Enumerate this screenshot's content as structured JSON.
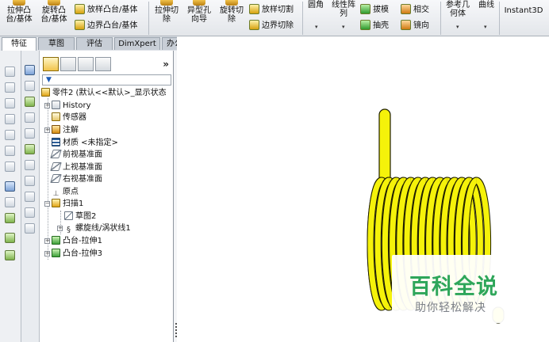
{
  "ribbon": {
    "extrude_boss": "拉伸凸\n台/基体",
    "revolve_boss": "旋转凸\n台/基体",
    "sweep_boss": "扫描",
    "loft_boss": "放样凸台/基体",
    "boundary_boss": "边界凸台/基体",
    "extrude_cut": "拉伸切\n除",
    "hole_wizard": "异型孔\n向导",
    "revolve_cut": "旋转切\n除",
    "loft_cut": "放样切割",
    "boundary_cut": "边界切除",
    "fillet": "圆角",
    "linear_pattern": "线性阵\n列",
    "draft": "拔模",
    "shell": "抽壳",
    "intersect": "相交",
    "mirror": "镜向",
    "ref_geometry": "参考几\n何体",
    "curves": "曲线",
    "instant3d": "Instant3D"
  },
  "tabs": [
    {
      "label": "特征",
      "active": true
    },
    {
      "label": "草图",
      "active": false
    },
    {
      "label": "评估",
      "active": false
    },
    {
      "label": "DimXpert",
      "active": false
    },
    {
      "label": "办公室产品",
      "active": false
    }
  ],
  "panel": {
    "more_glyph": "»",
    "filter_glyph": "▼"
  },
  "tree": {
    "root": "零件2 (默认<<默认>_显示状态",
    "items": [
      {
        "label": "History",
        "icon": "history-folder-icon"
      },
      {
        "label": "传感器",
        "icon": "sensor-icon"
      },
      {
        "label": "注解",
        "icon": "annotation-icon"
      },
      {
        "label": "材质 <未指定>",
        "icon": "material-icon"
      },
      {
        "label": "前视基准面",
        "icon": "plane-icon"
      },
      {
        "label": "上视基准面",
        "icon": "plane-icon"
      },
      {
        "label": "右视基准面",
        "icon": "plane-icon"
      },
      {
        "label": "原点",
        "icon": "origin-icon"
      },
      {
        "label": "扫描1",
        "icon": "sweep-icon"
      },
      {
        "label": "草图2",
        "icon": "sketch-icon"
      },
      {
        "label": "螺旋线/涡状线1",
        "icon": "helix-icon"
      },
      {
        "label": "凸台-拉伸1",
        "icon": "boss-extrude-icon"
      },
      {
        "label": "凸台-拉伸3",
        "icon": "boss-extrude-icon"
      }
    ]
  },
  "colors": {
    "spring": "#f5f20a",
    "spring_edge": "#1f1f00",
    "accent_green": "#2ea65a"
  },
  "watermark": {
    "logo": "百科全说",
    "tagline": "助你轻松解决"
  }
}
